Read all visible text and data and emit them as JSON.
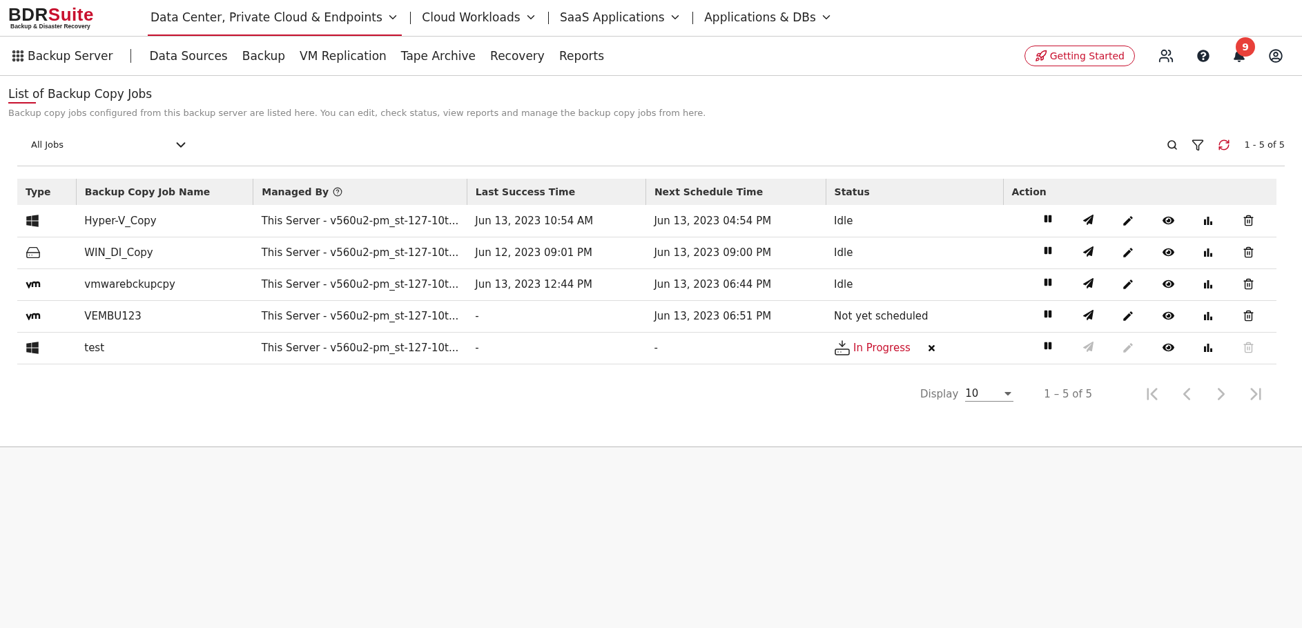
{
  "logo": {
    "brand": "BDR",
    "suffix": "Suite",
    "tagline": "Backup & Disaster Recovery"
  },
  "top_nav": [
    {
      "label": "Data Center, Private Cloud & Endpoints",
      "selected": true
    },
    {
      "label": "Cloud Workloads",
      "selected": false
    },
    {
      "label": "SaaS Applications",
      "selected": false
    },
    {
      "label": "Applications & DBs",
      "selected": false
    }
  ],
  "sub_nav": {
    "title": "Backup Server",
    "items": [
      {
        "label": "Data Sources",
        "selected": false
      },
      {
        "label": "Backup",
        "selected": false
      },
      {
        "label": "VM Replication",
        "selected": false
      },
      {
        "label": "Tape Archive",
        "selected": false
      },
      {
        "label": "Recovery",
        "selected": false
      },
      {
        "label": "Reports",
        "selected": false
      }
    ]
  },
  "header_actions": {
    "getting_started": "Getting Started",
    "notification_count": "9"
  },
  "page": {
    "title": "List of Backup Copy Jobs",
    "description": "Backup copy jobs configured from this backup server are listed here. You can edit, check status, view reports and manage the backup copy jobs from here."
  },
  "toolbar": {
    "job_filter": "All Jobs",
    "count": "1 - 5 of 5"
  },
  "table": {
    "columns": [
      "Type",
      "Backup Copy Job Name",
      "Managed By",
      "Last Success Time",
      "Next Schedule Time",
      "Status",
      "Action"
    ],
    "rows": [
      {
        "kind": "windows",
        "name": "Hyper-V_Copy",
        "managed_by": "This Server - v560u2-pm_st-127-10t...",
        "last_success": "Jun 13, 2023 10:54 AM",
        "next_schedule": "Jun 13, 2023 04:54 PM",
        "status": {
          "kind": "plain",
          "text": "Idle"
        },
        "actions": [
          {
            "kind": "pause",
            "disabled": false
          },
          {
            "kind": "send",
            "disabled": false
          },
          {
            "kind": "edit",
            "disabled": false
          },
          {
            "kind": "view",
            "disabled": false
          },
          {
            "kind": "report",
            "disabled": false
          },
          {
            "kind": "delete",
            "disabled": false
          }
        ]
      },
      {
        "kind": "disk",
        "name": "WIN_DI_Copy",
        "managed_by": "This Server - v560u2-pm_st-127-10t...",
        "last_success": "Jun 12, 2023 09:01 PM",
        "next_schedule": "Jun 13, 2023 09:00 PM",
        "status": {
          "kind": "plain",
          "text": "Idle"
        },
        "actions": [
          {
            "kind": "pause",
            "disabled": false
          },
          {
            "kind": "send",
            "disabled": false
          },
          {
            "kind": "edit",
            "disabled": false
          },
          {
            "kind": "view",
            "disabled": false
          },
          {
            "kind": "report",
            "disabled": false
          },
          {
            "kind": "delete",
            "disabled": false
          }
        ]
      },
      {
        "kind": "vmware",
        "name": "vmwarebckupcpy",
        "managed_by": "This Server - v560u2-pm_st-127-10t...",
        "last_success": "Jun 13, 2023 12:44 PM",
        "next_schedule": "Jun 13, 2023 06:44 PM",
        "status": {
          "kind": "plain",
          "text": "Idle"
        },
        "actions": [
          {
            "kind": "pause",
            "disabled": false
          },
          {
            "kind": "send",
            "disabled": false
          },
          {
            "kind": "edit",
            "disabled": false
          },
          {
            "kind": "view",
            "disabled": false
          },
          {
            "kind": "report",
            "disabled": false
          },
          {
            "kind": "delete",
            "disabled": false
          }
        ]
      },
      {
        "kind": "vmware",
        "name": "VEMBU123",
        "managed_by": "This Server - v560u2-pm_st-127-10t...",
        "last_success": "-",
        "next_schedule": "Jun 13, 2023 06:51 PM",
        "status": {
          "kind": "plain",
          "text": "Not yet scheduled"
        },
        "actions": [
          {
            "kind": "pause",
            "disabled": false
          },
          {
            "kind": "send",
            "disabled": false
          },
          {
            "kind": "edit",
            "disabled": false
          },
          {
            "kind": "view",
            "disabled": false
          },
          {
            "kind": "report",
            "disabled": false
          },
          {
            "kind": "delete",
            "disabled": false
          }
        ]
      },
      {
        "kind": "windows",
        "name": "test",
        "managed_by": "This Server - v560u2-pm_st-127-10t...",
        "last_success": "-",
        "next_schedule": "-",
        "status": {
          "kind": "progress",
          "text": "In Progress"
        },
        "actions": [
          {
            "kind": "pause",
            "disabled": false
          },
          {
            "kind": "send",
            "disabled": true
          },
          {
            "kind": "edit",
            "disabled": true
          },
          {
            "kind": "view",
            "disabled": false
          },
          {
            "kind": "report",
            "disabled": false
          },
          {
            "kind": "delete",
            "disabled": true
          }
        ]
      }
    ]
  },
  "pagination": {
    "label": "Display",
    "page_size": "10",
    "range": "1 – 5 of 5",
    "buttons": [
      {
        "kind": "first",
        "disabled": true
      },
      {
        "kind": "prev",
        "disabled": true
      },
      {
        "kind": "next",
        "disabled": true
      },
      {
        "kind": "last",
        "disabled": true
      }
    ]
  }
}
